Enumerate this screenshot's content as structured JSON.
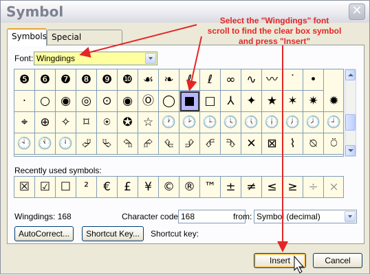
{
  "window": {
    "title": "Symbol",
    "close_label": "✕"
  },
  "tabs": [
    {
      "label": "Symbols",
      "active": true
    },
    {
      "label": "Special Characters",
      "active": false
    }
  ],
  "font": {
    "label": "Font:",
    "value": "Wingdings"
  },
  "symbol_grid": {
    "rows": [
      [
        "❺",
        "❻",
        "❼",
        "❽",
        "❾",
        "❿",
        "☙",
        "❧",
        "ℓ",
        "ℓ",
        "∞",
        "∿",
        "〰",
        "˙",
        "•"
      ],
      [
        "·",
        "○",
        "◉",
        "◎",
        "⊙",
        "◉",
        "Ⓞ",
        "◯",
        "■",
        "□",
        "⅄",
        "✦",
        "★",
        "✶",
        "✷",
        "✹",
        "✺"
      ],
      [
        "⌖",
        "⊕",
        "✧",
        "⌑",
        "⍟",
        "✪",
        "☆",
        "🕐",
        "🕑",
        "🕒",
        "🕓",
        "🕔",
        "🕕",
        "🕖",
        "🕗",
        "🕘"
      ],
      [
        "🕙",
        "🕚",
        "🕛",
        "⮰",
        "⮱",
        "⮲",
        "⮳",
        "⮴",
        "⮵",
        "⮶",
        "⮷",
        "✕",
        "⊠",
        "⌇",
        "⍉",
        "⍥"
      ]
    ],
    "selected_row": 1,
    "selected_col": 8
  },
  "recent": {
    "label": "Recently used symbols:",
    "symbols": [
      "☒",
      "☑",
      "☐",
      "²",
      "€",
      "£",
      "¥",
      "©",
      "®",
      "™",
      "±",
      "≠",
      "≤",
      "≥",
      "÷",
      "×"
    ]
  },
  "char_name": "Wingdings: 168",
  "character_code": {
    "label": "Character code:",
    "value": "168"
  },
  "from": {
    "label": "from:",
    "value": "Symbol (decimal)"
  },
  "buttons": {
    "autocorrect": "AutoCorrect...",
    "shortcut_key": "Shortcut Key...",
    "shortcut_key_label": "Shortcut key:",
    "insert": "Insert",
    "cancel": "Cancel"
  },
  "annotation": {
    "line1": "Select the \"Wingdings\" font",
    "line2": "scroll to find the clear box symbol",
    "line3": "and press \"Insert\""
  },
  "colors": {
    "grid_bg": "#fffbe5",
    "select_bg": "#ffffa0",
    "annotation": "#e32626",
    "selected_cell": "#b7b7ff"
  }
}
